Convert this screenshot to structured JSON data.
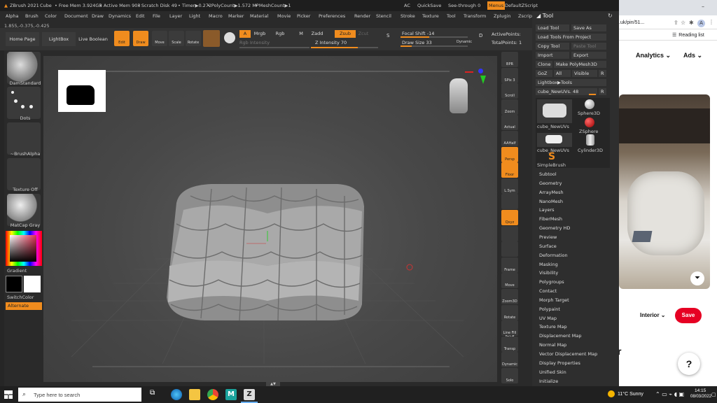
{
  "titlebar": {
    "app": "ZBrush 2021",
    "doc": "Cube",
    "free_mem": "• Free Mem 3.924GB",
    "active_mem": "• Active Mem 903",
    "scratch": "• Scratch Disk 49",
    "timer": "• Timer▶0.272",
    "polycount": "• PolyCount▶1.572 MP",
    "meshcount": "• MeshCount▶1",
    "ac": "AC",
    "quicksave": "QuickSave",
    "see_through": "See-through   0",
    "menus": "Menus",
    "script": "DefaultZScript"
  },
  "menubar": [
    "Alpha",
    "Brush",
    "Color",
    "Document",
    "Draw",
    "Dynamics",
    "Edit",
    "File",
    "Layer",
    "Light",
    "Macro",
    "Marker",
    "Material",
    "Movie",
    "Picker",
    "Preferences",
    "Render",
    "Stencil",
    "Stroke",
    "Texture",
    "Tool",
    "Transform",
    "Zplugin",
    "Zscript",
    "Help"
  ],
  "coords": "1.855,-0.375,-0.425",
  "shelf": {
    "home_page": "Home Page",
    "lightbox": "LightBox",
    "live_boolean": "Live Boolean",
    "edit": "Edit",
    "draw": "Draw",
    "move": "Move",
    "scale": "Scale",
    "rotate": "Rotate",
    "a": "A",
    "mrgb": "Mrgb",
    "rgb": "Rgb",
    "m": "M",
    "zadd": "Zadd",
    "zsub": "Zsub",
    "zcut": "Zcut",
    "rgb_intensity": "Rgb Intensity",
    "z_intensity": "Z Intensity 70",
    "focal_shift": "Focal Shift -14",
    "draw_size": "Draw Size 33",
    "dynamic": "Dynamic",
    "active_points": "ActivePoints:",
    "total_points": "TotalPoints: 1"
  },
  "shelf_levels": {
    "z_intensity": 0.7,
    "focal_shift": 0.43,
    "draw_size": 0.17
  },
  "leftpanel": {
    "brush": "DamStandard",
    "stroke": "Dots",
    "alpha": "~BrushAlpha",
    "texture": "Texture Off",
    "material": "MatCap Gray",
    "gradient": "Gradient",
    "switch_color": "SwitchColor",
    "alternate": "Alternate"
  },
  "rightstrip": [
    "BPR",
    "SPix 3",
    "Scroll",
    "Zoom",
    "Actual",
    "AAHalf",
    "Persp",
    "Floor",
    "L.Sym",
    "",
    "Qxyz",
    "",
    "",
    "Frame",
    "Move",
    "Zoom3D",
    "Rotate",
    "Line Fill PolyF",
    "Transp",
    "Dynamic",
    "Solo"
  ],
  "toolpanel": {
    "title": "Tool",
    "load_tool": "Load Tool",
    "save_as": "Save As",
    "load_from_project": "Load Tools From Project",
    "copy_tool": "Copy Tool",
    "paste_tool": "Paste Tool",
    "import": "Import",
    "export": "Export",
    "clone": "Clone",
    "make_polymesh": "Make PolyMesh3D",
    "goz": "GoZ",
    "all": "All",
    "visible": "Visible",
    "r": "R",
    "lightbox_tools": "Lightbox▶Tools",
    "current": "cube_NewUVs. 48",
    "r2": "R",
    "thumbs": [
      "cube_NewUVs",
      "Sphere3D",
      "ZSphere",
      "cube_NewUVs",
      "Cylinder3D",
      "SimpleBrush"
    ],
    "menus": [
      "Subtool",
      "Geometry",
      "ArrayMesh",
      "NanoMesh",
      "Layers",
      "FiberMesh",
      "Geometry HD",
      "Preview",
      "Surface",
      "Deformation",
      "Masking",
      "Visibility",
      "Polygroups",
      "Contact",
      "Morph Target",
      "Polypaint",
      "UV Map",
      "Texture Map",
      "Displacement Map",
      "Normal Map",
      "Vector Displacement Map",
      "Display Properties",
      "Unified Skin",
      "Initialize"
    ]
  },
  "browser": {
    "url": ".uk/pin/51...",
    "avatar": "A",
    "reading_list": "Reading list",
    "nav_analytics": "Analytics",
    "nav_ads": "Ads",
    "board": "Interior",
    "save": "Save",
    "help": "?",
    "partial": "r"
  },
  "taskbar": {
    "search_placeholder": "Type here to search",
    "weather": "11°C  Sunny",
    "time": "14:15",
    "date": "08/03/2022"
  },
  "colors": {
    "accent": "#f08c1e",
    "pinterest_red": "#e60023"
  }
}
